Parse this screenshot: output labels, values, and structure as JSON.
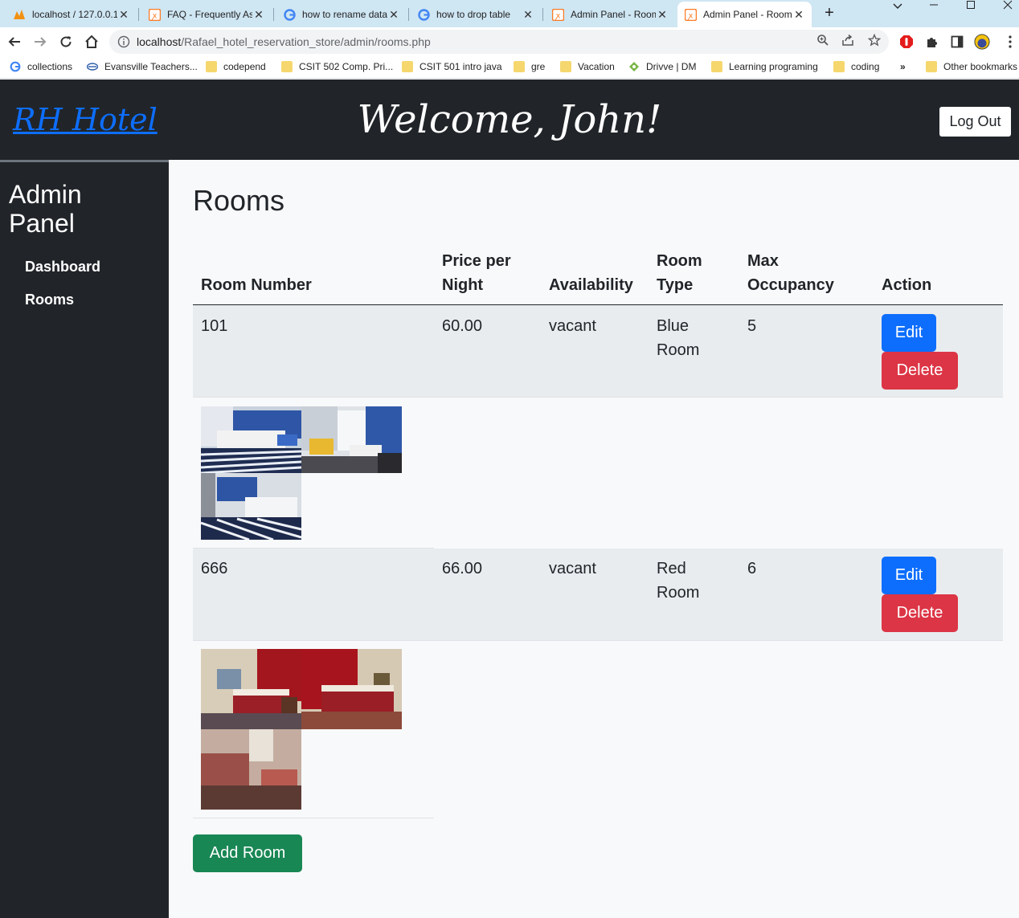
{
  "browser": {
    "tabs": [
      {
        "title": "localhost / 127.0.0.1",
        "icon": "phpmyadmin-icon",
        "active": false
      },
      {
        "title": "FAQ - Frequently Asked",
        "icon": "xampp-icon",
        "active": false
      },
      {
        "title": "how to rename database",
        "icon": "google-icon",
        "active": false
      },
      {
        "title": "how to drop table",
        "icon": "google-icon",
        "active": false
      },
      {
        "title": "Admin Panel - Rooms",
        "icon": "xampp-icon",
        "active": false
      },
      {
        "title": "Admin Panel - Rooms",
        "icon": "xampp-icon",
        "active": true
      }
    ],
    "url_host": "localhost",
    "url_path": "/Rafael_hotel_reservation_store/admin/rooms.php",
    "bookmarks": [
      {
        "label": "collections",
        "icon": "google-icon"
      },
      {
        "label": "Evansville Teachers...",
        "icon": "bank-icon"
      },
      {
        "label": "codepend",
        "icon": "folder-icon"
      },
      {
        "label": "CSIT 502 Comp. Pri...",
        "icon": "folder-icon"
      },
      {
        "label": "CSIT 501 intro java",
        "icon": "folder-icon"
      },
      {
        "label": "gre",
        "icon": "folder-icon"
      },
      {
        "label": "Vacation",
        "icon": "folder-icon"
      },
      {
        "label": "Drivve | DM",
        "icon": "drivve-icon"
      },
      {
        "label": "Learning programing",
        "icon": "folder-icon"
      },
      {
        "label": "coding",
        "icon": "folder-icon"
      }
    ],
    "bookmarks_overflow": "»",
    "other_bookmarks": "Other bookmarks"
  },
  "header": {
    "brand": "RH Hotel",
    "welcome": "Welcome, John!",
    "logout_label": "Log Out"
  },
  "sidebar": {
    "title": "Admin Panel",
    "items": [
      {
        "label": "Dashboard"
      },
      {
        "label": "Rooms"
      }
    ]
  },
  "main": {
    "title": "Rooms",
    "columns": [
      "Room Number",
      "Price per Night",
      "Availability",
      "Room Type",
      "Max Occupancy",
      "Action"
    ],
    "rows": [
      {
        "room_number": "101",
        "price": "60.00",
        "availability": "vacant",
        "room_type": "Blue Room",
        "max_occupancy": "5",
        "photo_theme": "blue"
      },
      {
        "room_number": "666",
        "price": "66.00",
        "availability": "vacant",
        "room_type": "Red Room",
        "max_occupancy": "6",
        "photo_theme": "red"
      }
    ],
    "edit_label": "Edit",
    "delete_label": "Delete",
    "add_label": "Add Room"
  },
  "colors": {
    "primary": "#0d6efd",
    "danger": "#dc3545",
    "success": "#198754",
    "dark": "#212529",
    "row_bg": "#e9ecef"
  }
}
